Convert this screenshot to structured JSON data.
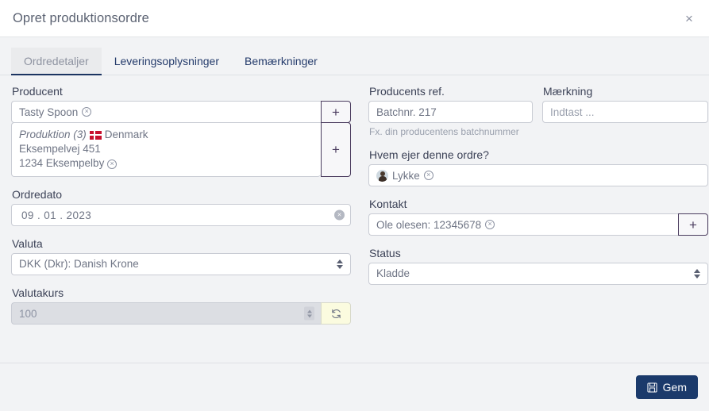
{
  "header": {
    "title": "Opret produktionsordre",
    "close_label": "×"
  },
  "tabs": [
    {
      "label": "Ordredetaljer",
      "active": true
    },
    {
      "label": "Leveringsoplysninger",
      "active": false
    },
    {
      "label": "Bemærkninger",
      "active": false
    }
  ],
  "left": {
    "producent": {
      "label": "Producent",
      "value": "Tasty Spoon",
      "add_label": "+",
      "address": {
        "name": "Produktion (3)",
        "country": "Denmark",
        "street": "Eksempelvej 451",
        "city": "1234 Eksempelby",
        "add_label": "+",
        "flag": "denmark-flag"
      }
    },
    "ordredato": {
      "label": "Ordredato",
      "value": "09 . 01 . 2023"
    },
    "valuta": {
      "label": "Valuta",
      "value": "DKK (Dkr): Danish Krone",
      "options": [
        "DKK (Dkr): Danish Krone"
      ]
    },
    "valutakurs": {
      "label": "Valutakurs",
      "value": "100",
      "refresh_label": "refresh-icon"
    }
  },
  "right": {
    "producents_ref": {
      "label": "Producents ref.",
      "value": "Batchnr. 217",
      "hint": "Fx. din producentens batchnummer"
    },
    "maerkning": {
      "label": "Mærkning",
      "value": "",
      "placeholder": "Indtast ..."
    },
    "owner": {
      "label": "Hvem ejer denne ordre?",
      "value": "Lykke"
    },
    "kontakt": {
      "label": "Kontakt",
      "value": "Ole olesen: 12345678",
      "add_label": "+"
    },
    "status": {
      "label": "Status",
      "value": "Kladde",
      "options": [
        "Kladde"
      ]
    }
  },
  "footer": {
    "save_label": "Gem"
  },
  "colors": {
    "accent": "#1b3a6b",
    "plus_border": "#4a3c5e",
    "flag_red": "#c8102e",
    "refresh_bg": "#fbfbdf",
    "page_bg": "#f2f3f5"
  }
}
